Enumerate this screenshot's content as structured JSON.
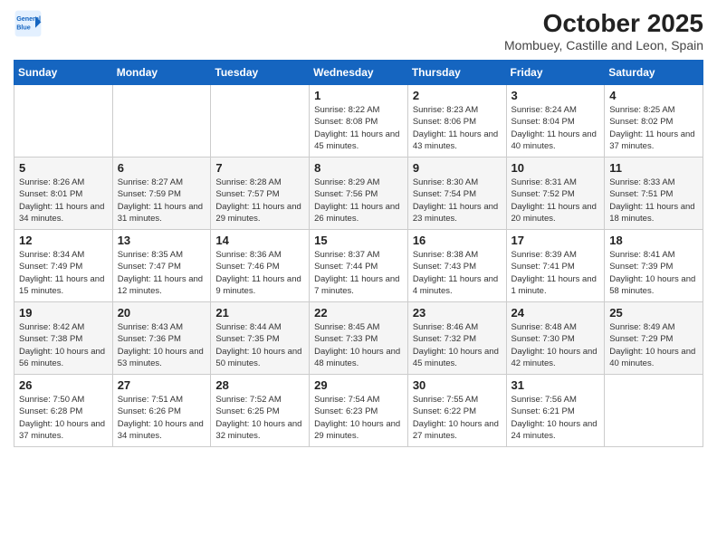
{
  "header": {
    "logo_line1": "General",
    "logo_line2": "Blue",
    "main_title": "October 2025",
    "sub_title": "Mombuey, Castille and Leon, Spain"
  },
  "weekdays": [
    "Sunday",
    "Monday",
    "Tuesday",
    "Wednesday",
    "Thursday",
    "Friday",
    "Saturday"
  ],
  "weeks": [
    [
      {
        "day": "",
        "info": ""
      },
      {
        "day": "",
        "info": ""
      },
      {
        "day": "",
        "info": ""
      },
      {
        "day": "1",
        "info": "Sunrise: 8:22 AM\nSunset: 8:08 PM\nDaylight: 11 hours\nand 45 minutes."
      },
      {
        "day": "2",
        "info": "Sunrise: 8:23 AM\nSunset: 8:06 PM\nDaylight: 11 hours\nand 43 minutes."
      },
      {
        "day": "3",
        "info": "Sunrise: 8:24 AM\nSunset: 8:04 PM\nDaylight: 11 hours\nand 40 minutes."
      },
      {
        "day": "4",
        "info": "Sunrise: 8:25 AM\nSunset: 8:02 PM\nDaylight: 11 hours\nand 37 minutes."
      }
    ],
    [
      {
        "day": "5",
        "info": "Sunrise: 8:26 AM\nSunset: 8:01 PM\nDaylight: 11 hours\nand 34 minutes."
      },
      {
        "day": "6",
        "info": "Sunrise: 8:27 AM\nSunset: 7:59 PM\nDaylight: 11 hours\nand 31 minutes."
      },
      {
        "day": "7",
        "info": "Sunrise: 8:28 AM\nSunset: 7:57 PM\nDaylight: 11 hours\nand 29 minutes."
      },
      {
        "day": "8",
        "info": "Sunrise: 8:29 AM\nSunset: 7:56 PM\nDaylight: 11 hours\nand 26 minutes."
      },
      {
        "day": "9",
        "info": "Sunrise: 8:30 AM\nSunset: 7:54 PM\nDaylight: 11 hours\nand 23 minutes."
      },
      {
        "day": "10",
        "info": "Sunrise: 8:31 AM\nSunset: 7:52 PM\nDaylight: 11 hours\nand 20 minutes."
      },
      {
        "day": "11",
        "info": "Sunrise: 8:33 AM\nSunset: 7:51 PM\nDaylight: 11 hours\nand 18 minutes."
      }
    ],
    [
      {
        "day": "12",
        "info": "Sunrise: 8:34 AM\nSunset: 7:49 PM\nDaylight: 11 hours\nand 15 minutes."
      },
      {
        "day": "13",
        "info": "Sunrise: 8:35 AM\nSunset: 7:47 PM\nDaylight: 11 hours\nand 12 minutes."
      },
      {
        "day": "14",
        "info": "Sunrise: 8:36 AM\nSunset: 7:46 PM\nDaylight: 11 hours\nand 9 minutes."
      },
      {
        "day": "15",
        "info": "Sunrise: 8:37 AM\nSunset: 7:44 PM\nDaylight: 11 hours\nand 7 minutes."
      },
      {
        "day": "16",
        "info": "Sunrise: 8:38 AM\nSunset: 7:43 PM\nDaylight: 11 hours\nand 4 minutes."
      },
      {
        "day": "17",
        "info": "Sunrise: 8:39 AM\nSunset: 7:41 PM\nDaylight: 11 hours\nand 1 minute."
      },
      {
        "day": "18",
        "info": "Sunrise: 8:41 AM\nSunset: 7:39 PM\nDaylight: 10 hours\nand 58 minutes."
      }
    ],
    [
      {
        "day": "19",
        "info": "Sunrise: 8:42 AM\nSunset: 7:38 PM\nDaylight: 10 hours\nand 56 minutes."
      },
      {
        "day": "20",
        "info": "Sunrise: 8:43 AM\nSunset: 7:36 PM\nDaylight: 10 hours\nand 53 minutes."
      },
      {
        "day": "21",
        "info": "Sunrise: 8:44 AM\nSunset: 7:35 PM\nDaylight: 10 hours\nand 50 minutes."
      },
      {
        "day": "22",
        "info": "Sunrise: 8:45 AM\nSunset: 7:33 PM\nDaylight: 10 hours\nand 48 minutes."
      },
      {
        "day": "23",
        "info": "Sunrise: 8:46 AM\nSunset: 7:32 PM\nDaylight: 10 hours\nand 45 minutes."
      },
      {
        "day": "24",
        "info": "Sunrise: 8:48 AM\nSunset: 7:30 PM\nDaylight: 10 hours\nand 42 minutes."
      },
      {
        "day": "25",
        "info": "Sunrise: 8:49 AM\nSunset: 7:29 PM\nDaylight: 10 hours\nand 40 minutes."
      }
    ],
    [
      {
        "day": "26",
        "info": "Sunrise: 7:50 AM\nSunset: 6:28 PM\nDaylight: 10 hours\nand 37 minutes."
      },
      {
        "day": "27",
        "info": "Sunrise: 7:51 AM\nSunset: 6:26 PM\nDaylight: 10 hours\nand 34 minutes."
      },
      {
        "day": "28",
        "info": "Sunrise: 7:52 AM\nSunset: 6:25 PM\nDaylight: 10 hours\nand 32 minutes."
      },
      {
        "day": "29",
        "info": "Sunrise: 7:54 AM\nSunset: 6:23 PM\nDaylight: 10 hours\nand 29 minutes."
      },
      {
        "day": "30",
        "info": "Sunrise: 7:55 AM\nSunset: 6:22 PM\nDaylight: 10 hours\nand 27 minutes."
      },
      {
        "day": "31",
        "info": "Sunrise: 7:56 AM\nSunset: 6:21 PM\nDaylight: 10 hours\nand 24 minutes."
      },
      {
        "day": "",
        "info": ""
      }
    ]
  ]
}
